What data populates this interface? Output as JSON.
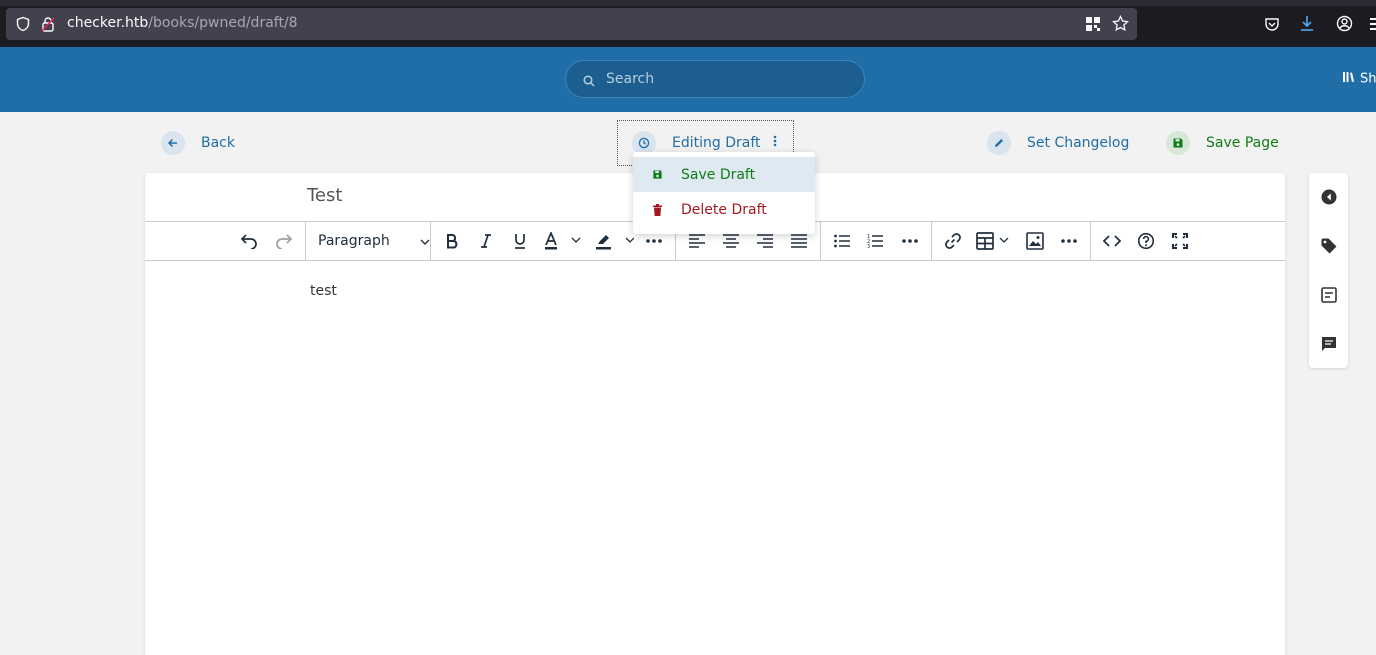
{
  "browser": {
    "url_host": "checker.htb",
    "url_path": "/books/pwned/draft/8"
  },
  "header": {
    "search_placeholder": "Search",
    "shelves_label": "Sh"
  },
  "actions": {
    "back": "Back",
    "editing_draft": "Editing Draft",
    "set_changelog": "Set Changelog",
    "save_page": "Save Page"
  },
  "dropdown": {
    "save_draft": "Save Draft",
    "delete_draft": "Delete Draft"
  },
  "editor": {
    "title": "Test",
    "block_format": "Paragraph",
    "content": "test"
  },
  "colors": {
    "header_bg": "#206ea7",
    "link": "#206ea7",
    "save_green": "#0f7d15",
    "delete_red": "#a4191f"
  }
}
